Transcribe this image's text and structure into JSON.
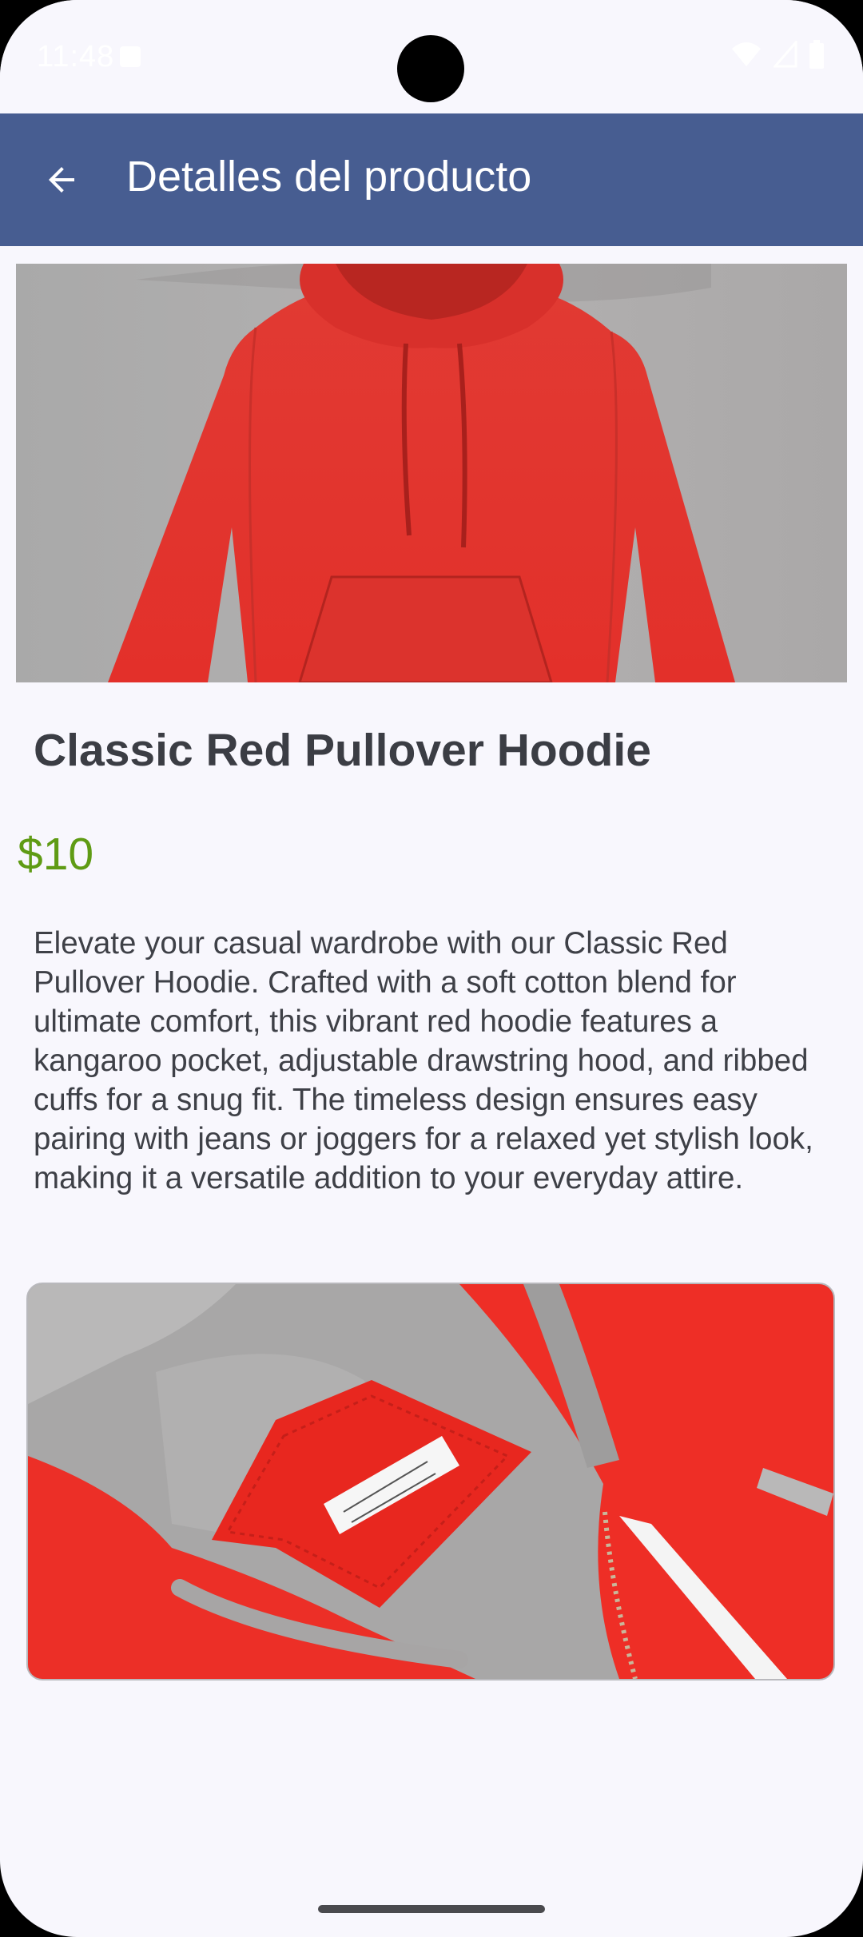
{
  "status_bar": {
    "time": "11:48",
    "icons": [
      "notification-icon",
      "wifi-icon",
      "signal-icon",
      "battery-icon"
    ]
  },
  "app_bar": {
    "title": "Detalles del producto",
    "back_icon": "arrow-back-icon",
    "background": "#475d91"
  },
  "product": {
    "name": "Classic Red Pullover Hoodie",
    "price": "$10",
    "description": "Elevate your casual wardrobe with our Classic Red Pullover Hoodie. Crafted with a soft cotton blend for ultimate comfort, this vibrant red hoodie features a kangaroo pocket, adjustable drawstring hood, and ribbed cuffs for a snug fit. The timeless design ensures easy pairing with jeans or joggers for a relaxed yet stylish look, making it a versatile addition to your everyday attire.",
    "price_color": "#5f9b14",
    "accent_red": "#e5302c"
  }
}
